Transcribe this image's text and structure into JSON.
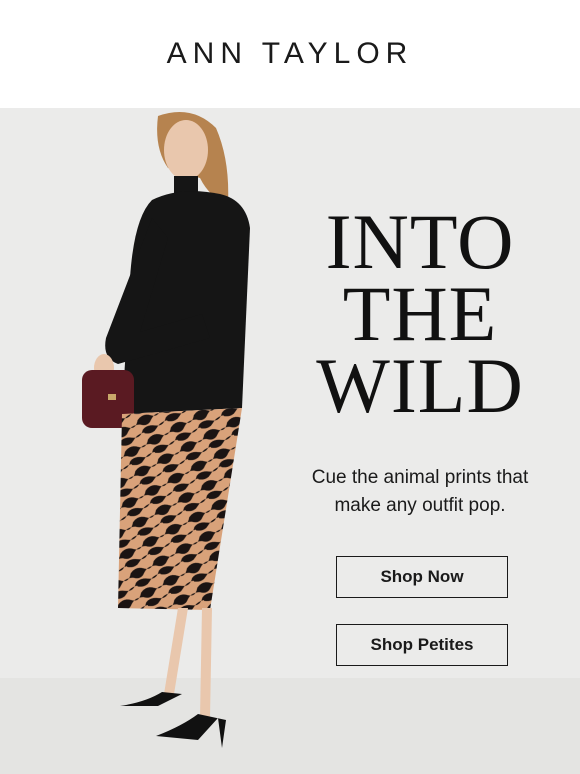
{
  "header": {
    "brand": "ANN TAYLOR"
  },
  "hero": {
    "headline": [
      "INTO",
      "THE",
      "WILD"
    ],
    "subtext": "Cue the animal prints that make any outfit pop.",
    "buttons": {
      "shop_now": "Shop Now",
      "shop_petites": "Shop Petites"
    }
  },
  "colors": {
    "background": "#ebebea",
    "text": "#111111",
    "sweater": "#151515",
    "skirt": "#d9a27a",
    "bag": "#5a1a22"
  }
}
